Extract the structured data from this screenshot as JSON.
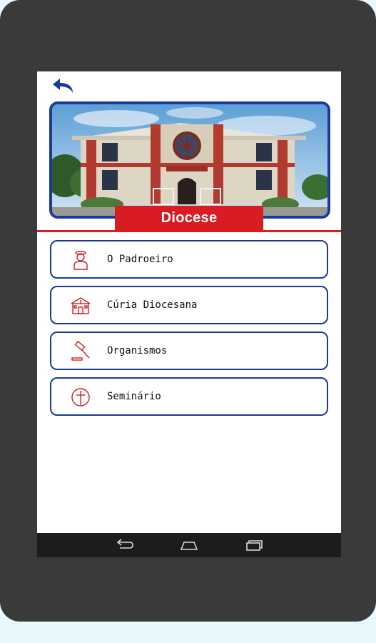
{
  "colors": {
    "brand_blue": "#1b3a9e",
    "brand_red": "#d81c24",
    "device": "#3a3a3a",
    "navbar": "#1c1c1c"
  },
  "header": {
    "back_icon": "back-arrow-icon",
    "image_alt": "Cathedral building photo"
  },
  "section": {
    "title": "Diocese"
  },
  "menu": {
    "items": [
      {
        "label": "O Padroeiro",
        "icon": "saint-icon"
      },
      {
        "label": "Cúria Diocesana",
        "icon": "church-building-icon"
      },
      {
        "label": "Organismos",
        "icon": "gavel-icon"
      },
      {
        "label": "Seminário",
        "icon": "cross-circle-icon"
      }
    ]
  },
  "navbar": {
    "buttons": [
      "back-nav-icon",
      "home-nav-icon",
      "recents-nav-icon"
    ]
  }
}
